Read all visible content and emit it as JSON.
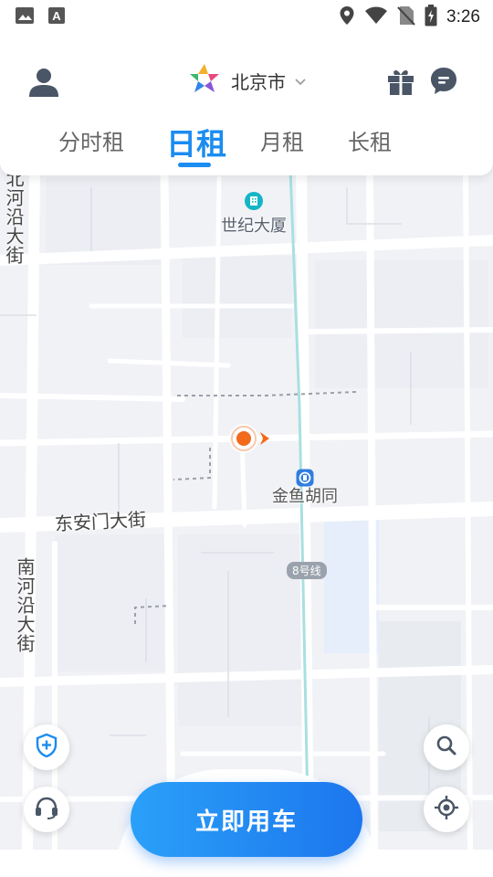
{
  "status_bar": {
    "time": "3:26",
    "icons": [
      "image-icon",
      "text-a-icon",
      "location-icon",
      "wifi-icon",
      "no-sim-icon",
      "battery-charging-icon"
    ]
  },
  "header": {
    "city": "北京市",
    "logo_icon": "star-logo-icon",
    "left_icon": "user-icon",
    "right_icons": [
      "gift-icon",
      "message-icon"
    ]
  },
  "tabs": [
    {
      "label": "分时租",
      "active": false
    },
    {
      "label": "日租",
      "active": true
    },
    {
      "label": "月租",
      "active": false
    },
    {
      "label": "长租",
      "active": false
    }
  ],
  "map": {
    "labels": {
      "north_street": "北河沿大街",
      "south_street": "南河沿大街",
      "dongan_street": "东安门大街",
      "building": "世纪大厦",
      "station": "金鱼胡同",
      "metro_line": "8号线"
    }
  },
  "buttons": {
    "cta": "立即用车",
    "left_icons": [
      "shield-plus-icon",
      "headset-icon"
    ],
    "right_icons": [
      "search-icon",
      "locate-icon"
    ]
  },
  "colors": {
    "accent": "#1b8cf0",
    "marker": "#f26a1b",
    "poi_teal": "#14b5c6",
    "metro_blue": "#2f7de0"
  }
}
